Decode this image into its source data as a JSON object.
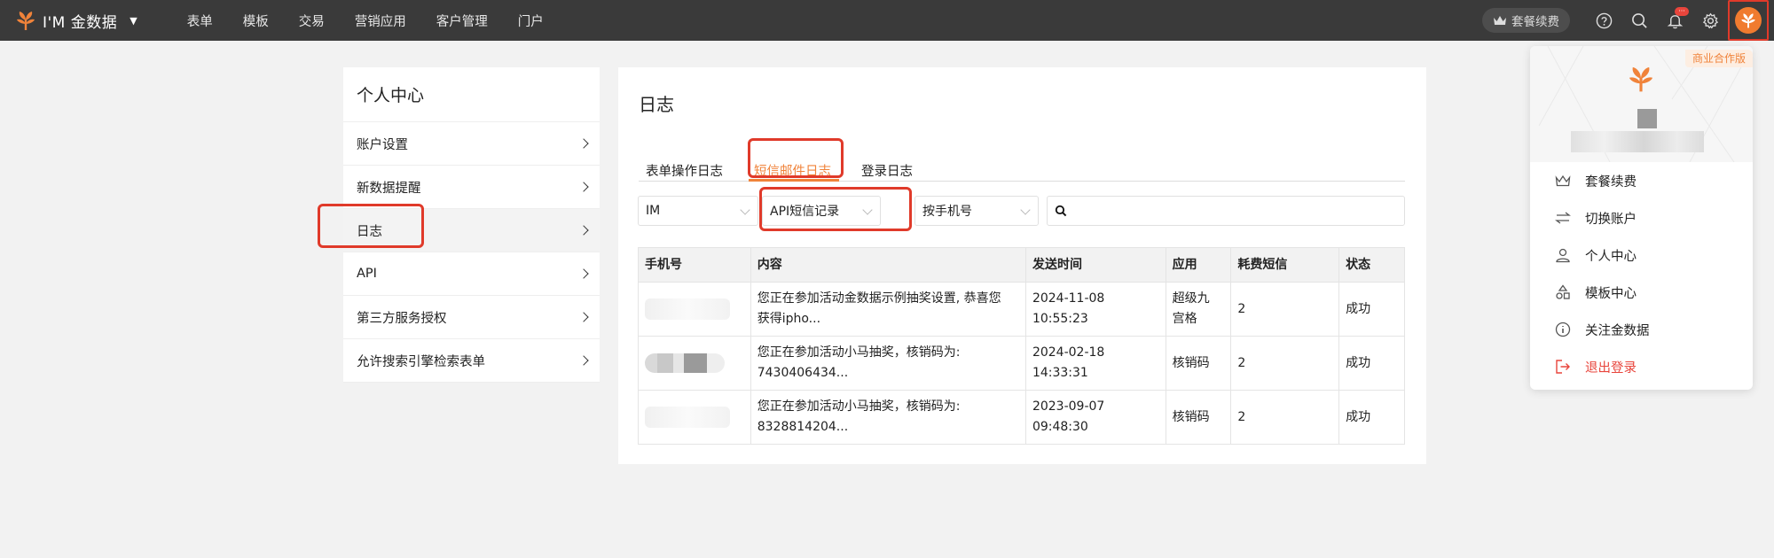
{
  "topbar": {
    "brand": "I'M 金数据",
    "nav": [
      "表单",
      "模板",
      "交易",
      "营销应用",
      "客户管理",
      "门户"
    ],
    "renew_label": "套餐续费",
    "notification_badge": "···"
  },
  "sidebar": {
    "title": "个人中心",
    "items": [
      "账户设置",
      "新数据提醒",
      "日志",
      "API",
      "第三方服务授权",
      "允许搜索引擎检索表单"
    ],
    "active_index": 2
  },
  "main": {
    "title": "日志",
    "tabs": [
      "表单操作日志",
      "短信邮件日志",
      "登录日志"
    ],
    "active_tab": 1,
    "filters": {
      "source": "IM",
      "record_type": "API短信记录",
      "search_by": "按手机号",
      "search_value": ""
    },
    "table": {
      "headers": [
        "手机号",
        "内容",
        "发送时间",
        "应用",
        "耗费短信",
        "状态"
      ],
      "rows": [
        {
          "phone": "",
          "content_line1": "您正在参加活动金数据示例抽奖设置, 恭喜您",
          "content_line2": "获得ipho...",
          "date": "2024-11-08",
          "time": "10:55:23",
          "app_line1": "超级九",
          "app_line2": "宫格",
          "cost": "2",
          "status": "成功"
        },
        {
          "phone": "",
          "content_line1": "您正在参加活动小马抽奖，核销码为:",
          "content_line2": "7430406434...",
          "date": "2024-02-18",
          "time": "14:33:31",
          "app_line1": "核销码",
          "app_line2": "",
          "cost": "2",
          "status": "成功"
        },
        {
          "phone": "",
          "content_line1": "您正在参加活动小马抽奖，核销码为:",
          "content_line2": "8328814204...",
          "date": "2023-09-07",
          "time": "09:48:30",
          "app_line1": "核销码",
          "app_line2": "",
          "cost": "2",
          "status": "成功"
        }
      ]
    }
  },
  "user_menu": {
    "tag": "商业合作版",
    "items": [
      "套餐续费",
      "切换账户",
      "个人中心",
      "模板中心",
      "关注金数据",
      "退出登录"
    ]
  },
  "colors": {
    "accent": "#f0833a",
    "highlight": "#e03a2a",
    "topbar": "#3a3a3a"
  }
}
